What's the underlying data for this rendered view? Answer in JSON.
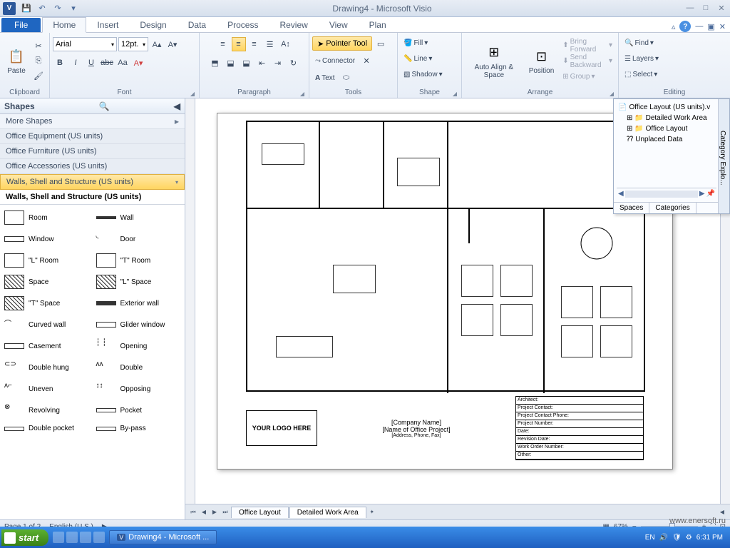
{
  "title": "Drawing4 - Microsoft Visio",
  "ribbon_tabs": [
    "Home",
    "Insert",
    "Design",
    "Data",
    "Process",
    "Review",
    "View",
    "Plan"
  ],
  "file_tab": "File",
  "groups": {
    "clipboard": "Clipboard",
    "font": "Font",
    "paragraph": "Paragraph",
    "tools": "Tools",
    "shape": "Shape",
    "arrange": "Arrange",
    "editing": "Editing"
  },
  "paste": "Paste",
  "font_name": "Arial",
  "font_size": "12pt.",
  "pointer_tool": "Pointer Tool",
  "connector": "Connector",
  "text_tool": "Text",
  "fill": "Fill",
  "line": "Line",
  "shadow": "Shadow",
  "autoalign": "Auto Align & Space",
  "position": "Position",
  "bring_forward": "Bring Forward",
  "send_backward": "Send Backward",
  "group_cmd": "Group",
  "find": "Find",
  "layers": "Layers",
  "select": "Select",
  "shapes_panel": {
    "title": "Shapes",
    "more": "More Shapes",
    "stencils": [
      "Office Equipment (US units)",
      "Office Furniture (US units)",
      "Office Accessories (US units)",
      "Walls, Shell and Structure (US units)"
    ],
    "active_title": "Walls, Shell and Structure (US units)",
    "items": [
      "Room",
      "Wall",
      "Window",
      "Door",
      "\"L\" Room",
      "\"T\" Room",
      "Space",
      "\"L\" Space",
      "\"T\" Space",
      "Exterior wall",
      "Curved wall",
      "Glider window",
      "Casement",
      "Opening",
      "Double hung",
      "Double",
      "Uneven",
      "Opposing",
      "Revolving",
      "Pocket",
      "Double pocket",
      "By-pass"
    ]
  },
  "catexp": {
    "side": "Category Explo...",
    "root": "Office Layout (US units).v",
    "items": [
      "Detailed Work Area",
      "Office Layout",
      "Unplaced Data"
    ],
    "tabs": [
      "Spaces",
      "Categories"
    ]
  },
  "titleblock": {
    "logo": "YOUR LOGO HERE",
    "company": "[Company Name]",
    "project": "[Name of Office Project]",
    "address": "[Address, Phone, Fax]",
    "fields": [
      "Architect:",
      "Project Contact:",
      "Project Contact Phone:",
      "Project Number:",
      "Date:",
      "Revision Date:",
      "Work Order Number:",
      "Other:"
    ]
  },
  "page_tabs": [
    "Office Layout",
    "Detailed Work Area"
  ],
  "status": {
    "page": "Page 1 of 2",
    "lang": "English (U.S.)",
    "zoom": "67%"
  },
  "taskbar": {
    "start": "start",
    "task": "Drawing4 - Microsoft ...",
    "lang": "EN",
    "time": "6:31 PM"
  },
  "watermark": "www.enersoft.ru"
}
